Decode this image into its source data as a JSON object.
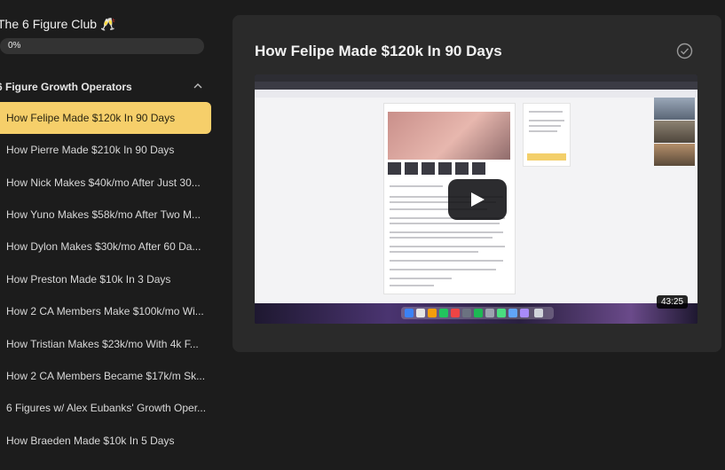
{
  "course": {
    "title": "The 6 Figure Club 🥂",
    "progress_text": "0%",
    "progress": 0
  },
  "section": {
    "title": "6 Figure Growth Operators",
    "chevron_icon": "chevron-up-icon"
  },
  "lessons": [
    {
      "label": "How Felipe Made $120k In 90 Days",
      "active": true
    },
    {
      "label": "How Pierre Made $210k In 90 Days"
    },
    {
      "label": "How Nick Makes $40k/mo After Just 30..."
    },
    {
      "label": "How Yuno Makes $58k/mo After Two M..."
    },
    {
      "label": "How Dylon Makes $30k/mo After 60 Da..."
    },
    {
      "label": "How Preston Made $10k In 3 Days"
    },
    {
      "label": "How 2 CA Members Make $100k/mo Wi..."
    },
    {
      "label": "How Tristian Makes $23k/mo With 4k F..."
    },
    {
      "label": "How 2 CA Members Became $17k/m Sk..."
    },
    {
      "label": "6 Figures w/ Alex Eubanks' Growth Oper..."
    },
    {
      "label": "How Braeden Made $10k In 5 Days"
    }
  ],
  "main": {
    "heading": "How Felipe Made $120k In 90 Days",
    "complete_icon": "check-circle-icon",
    "video": {
      "duration": "43:25",
      "play_icon": "play-icon"
    }
  },
  "colors": {
    "background": "#1c1c1c",
    "card": "#2a2a2a",
    "active_lesson": "#f6cf6a"
  }
}
